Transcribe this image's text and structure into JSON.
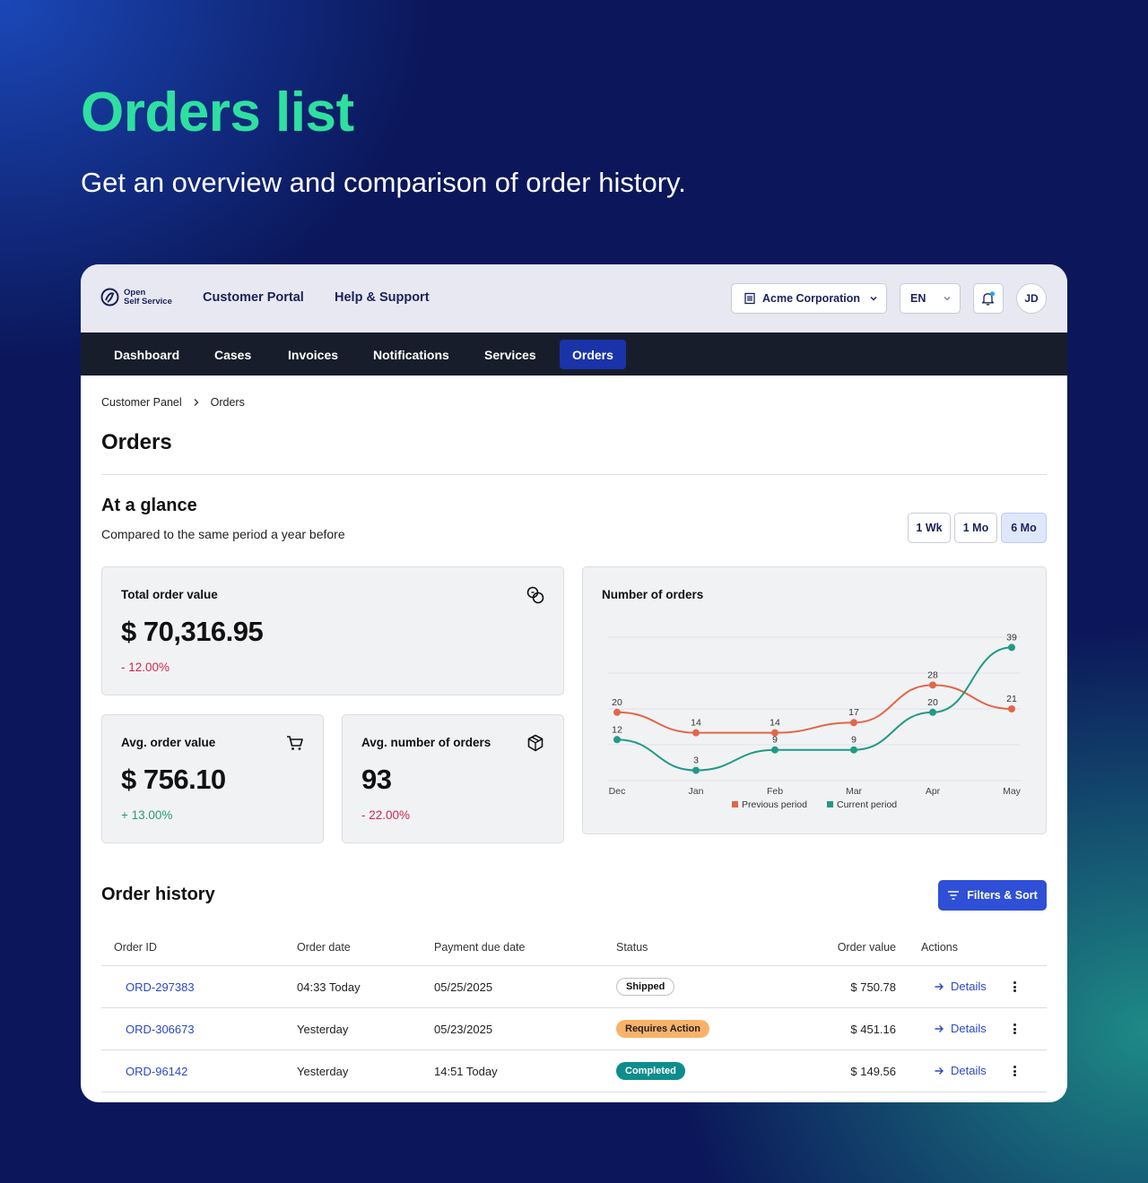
{
  "hero": {
    "title": "Orders list",
    "subtitle": "Get an overview and comparison of order history."
  },
  "topbar": {
    "logo_line1": "Open",
    "logo_line2": "Self Service",
    "links": [
      "Customer Portal",
      "Help & Support"
    ],
    "organization": "Acme Corporation",
    "language": "EN",
    "avatar_initials": "JD",
    "notification_dot_color": "#2aa6e8"
  },
  "nav": {
    "items": [
      "Dashboard",
      "Cases",
      "Invoices",
      "Notifications",
      "Services",
      "Orders"
    ],
    "active": "Orders"
  },
  "breadcrumb": [
    "Customer Panel",
    "Orders"
  ],
  "page_title": "Orders",
  "glance": {
    "title": "At a glance",
    "subtitle": "Compared to the same period a year before",
    "periods": [
      "1 Wk",
      "1 Mo",
      "6 Mo"
    ],
    "active_period": "6 Mo"
  },
  "stats": {
    "total": {
      "label": "Total order value",
      "value": "$ 70,316.95",
      "change": "- 12.00%",
      "trend": "negative"
    },
    "avg_value": {
      "label": "Avg. order value",
      "value": "$ 756.10",
      "change": "+ 13.00%",
      "trend": "positive"
    },
    "avg_count": {
      "label": "Avg. number of orders",
      "value": "93",
      "change": "- 22.00%",
      "trend": "negative"
    }
  },
  "chart_data": {
    "type": "line",
    "title": "Number of orders",
    "categories": [
      "Dec",
      "Jan",
      "Feb",
      "Mar",
      "Apr",
      "May"
    ],
    "series": [
      {
        "name": "Previous period",
        "color": "#e2674a",
        "values": [
          20,
          14,
          14,
          17,
          28,
          21
        ]
      },
      {
        "name": "Current period",
        "color": "#219a86",
        "values": [
          12,
          3,
          9,
          9,
          20,
          39
        ]
      }
    ],
    "ylim": [
      0,
      42
    ],
    "legend": "bottom",
    "grid": true
  },
  "order_history": {
    "title": "Order history",
    "filter_label": "Filters & Sort",
    "columns": [
      "Order ID",
      "Order date",
      "Payment due date",
      "Status",
      "Order value",
      "Actions"
    ],
    "rows": [
      {
        "id": "ORD-297383",
        "date": "04:33 Today",
        "due": "05/25/2025",
        "status": "Shipped",
        "status_kind": "shipped",
        "value": "$ 750.78",
        "action": "Details"
      },
      {
        "id": "ORD-306673",
        "date": "Yesterday",
        "due": "05/23/2025",
        "status": "Requires Action",
        "status_kind": "action",
        "value": "$ 451.16",
        "action": "Details"
      },
      {
        "id": "ORD-96142",
        "date": "Yesterday",
        "due": "14:51 Today",
        "status": "Completed",
        "status_kind": "completed",
        "value": "$ 149.56",
        "action": "Details"
      }
    ]
  }
}
